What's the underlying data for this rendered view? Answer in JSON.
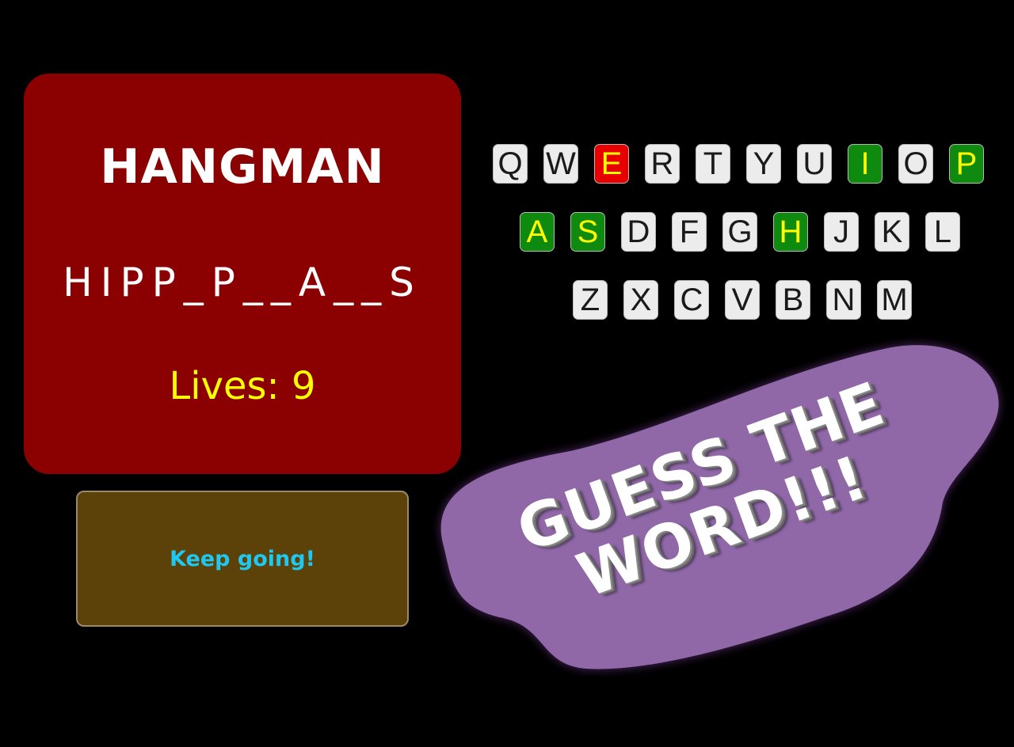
{
  "game": {
    "title": "HANGMAN",
    "word_display": "HIPP_P__A__S",
    "lives_text": "Lives: 9",
    "message": "Keep going!"
  },
  "keyboard": {
    "rows": [
      [
        {
          "letter": "Q",
          "state": "unused"
        },
        {
          "letter": "W",
          "state": "unused"
        },
        {
          "letter": "E",
          "state": "wrong"
        },
        {
          "letter": "R",
          "state": "unused"
        },
        {
          "letter": "T",
          "state": "unused"
        },
        {
          "letter": "Y",
          "state": "unused"
        },
        {
          "letter": "U",
          "state": "unused"
        },
        {
          "letter": "I",
          "state": "correct"
        },
        {
          "letter": "O",
          "state": "unused"
        },
        {
          "letter": "P",
          "state": "correct"
        }
      ],
      [
        {
          "letter": "A",
          "state": "correct"
        },
        {
          "letter": "S",
          "state": "correct"
        },
        {
          "letter": "D",
          "state": "unused"
        },
        {
          "letter": "F",
          "state": "unused"
        },
        {
          "letter": "G",
          "state": "unused"
        },
        {
          "letter": "H",
          "state": "correct"
        },
        {
          "letter": "J",
          "state": "unused"
        },
        {
          "letter": "K",
          "state": "unused"
        },
        {
          "letter": "L",
          "state": "unused"
        }
      ],
      [
        {
          "letter": "Z",
          "state": "unused"
        },
        {
          "letter": "X",
          "state": "unused"
        },
        {
          "letter": "C",
          "state": "unused"
        },
        {
          "letter": "V",
          "state": "unused"
        },
        {
          "letter": "B",
          "state": "unused"
        },
        {
          "letter": "N",
          "state": "unused"
        },
        {
          "letter": "M",
          "state": "unused"
        }
      ]
    ]
  },
  "banner": {
    "line1": "GUESS THE",
    "line2": "WORD!!!"
  },
  "colors": {
    "background": "#000000",
    "panel": "#8b0000",
    "title": "#ffffff",
    "lives": "#ffff00",
    "message_box": "#5c4108",
    "message_text": "#1ec8f0",
    "key_default": "#ececec",
    "key_wrong": "#e80000",
    "key_correct": "#0e8a0e",
    "key_highlight_text": "#ffff00",
    "banner_blob": "#9068a8"
  }
}
